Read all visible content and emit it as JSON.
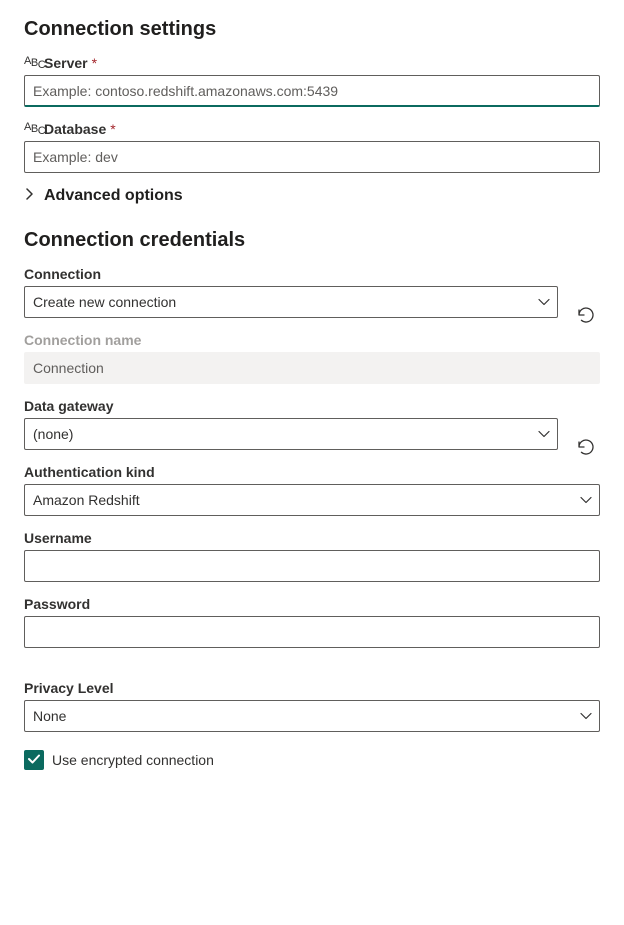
{
  "section_settings": {
    "title": "Connection settings",
    "server": {
      "label": "Server",
      "placeholder": "Example: contoso.redshift.amazonaws.com:5439",
      "value": ""
    },
    "database": {
      "label": "Database",
      "placeholder": "Example: dev",
      "value": ""
    },
    "advanced_label": "Advanced options"
  },
  "section_credentials": {
    "title": "Connection credentials",
    "connection": {
      "label": "Connection",
      "selected": "Create new connection"
    },
    "connection_name": {
      "label": "Connection name",
      "placeholder": "Connection",
      "value": ""
    },
    "data_gateway": {
      "label": "Data gateway",
      "selected": "(none)"
    },
    "auth_kind": {
      "label": "Authentication kind",
      "selected": "Amazon Redshift"
    },
    "username": {
      "label": "Username",
      "value": ""
    },
    "password": {
      "label": "Password",
      "value": ""
    },
    "privacy": {
      "label": "Privacy Level",
      "selected": "None"
    },
    "encrypted": {
      "label": "Use encrypted connection",
      "checked": true
    }
  }
}
